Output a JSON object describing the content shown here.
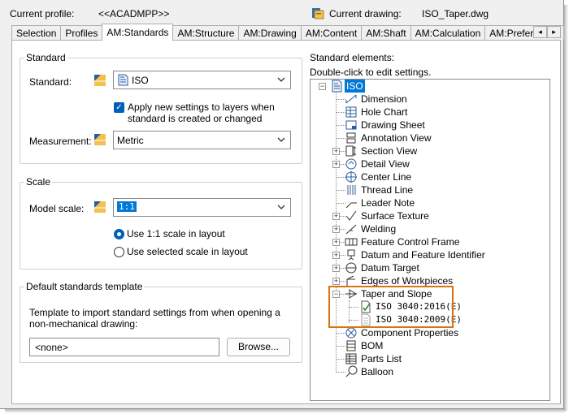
{
  "header": {
    "current_profile_label": "Current profile:",
    "current_profile_value": "<<ACADMPP>>",
    "current_drawing_label": "Current drawing:",
    "current_drawing_value": "ISO_Taper.dwg"
  },
  "tabs": [
    "Selection",
    "Profiles",
    "AM:Standards",
    "AM:Structure",
    "AM:Drawing",
    "AM:Content",
    "AM:Shaft",
    "AM:Calculation",
    "AM:Preferences"
  ],
  "tab_scroll": {
    "left": "◂",
    "right": "▸"
  },
  "standard_group": {
    "title": "Standard",
    "standard_label": "Standard:",
    "standard_value": "ISO",
    "checkbox_label_1": "Apply new settings to layers when",
    "checkbox_label_2": "standard is created or changed",
    "checkbox_checked": true,
    "measurement_label": "Measurement:",
    "measurement_value": "Metric"
  },
  "scale_group": {
    "title": "Scale",
    "model_scale_label": "Model scale:",
    "model_scale_value": "1:1",
    "radio_1_label": "Use 1:1 scale in layout",
    "radio_2_label": "Use selected scale in layout",
    "selected_radio": 1
  },
  "template_group": {
    "title": "Default standards template",
    "description_1": "Template to import standard settings from when opening a",
    "description_2": "non-mechanical drawing:",
    "template_value": "<none>",
    "browse_label": "Browse..."
  },
  "elements": {
    "title": "Standard elements:",
    "hint": "Double-click to edit settings.",
    "root": "ISO",
    "items": [
      {
        "label": "Dimension",
        "icon": "dimension-icon",
        "expandable": false
      },
      {
        "label": "Hole Chart",
        "icon": "hole-chart-icon",
        "expandable": false
      },
      {
        "label": "Drawing Sheet",
        "icon": "drawing-sheet-icon",
        "expandable": false
      },
      {
        "label": "Annotation View",
        "icon": "annotation-view-icon",
        "expandable": false
      },
      {
        "label": "Section View",
        "icon": "section-view-icon",
        "expandable": true
      },
      {
        "label": "Detail View",
        "icon": "detail-view-icon",
        "expandable": true
      },
      {
        "label": "Center Line",
        "icon": "center-line-icon",
        "expandable": false
      },
      {
        "label": "Thread Line",
        "icon": "thread-line-icon",
        "expandable": false
      },
      {
        "label": "Leader Note",
        "icon": "leader-note-icon",
        "expandable": false
      },
      {
        "label": "Surface Texture",
        "icon": "surface-texture-icon",
        "expandable": true
      },
      {
        "label": "Welding",
        "icon": "welding-icon",
        "expandable": true
      },
      {
        "label": "Feature Control Frame",
        "icon": "feature-control-frame-icon",
        "expandable": true
      },
      {
        "label": "Datum and Feature Identifier",
        "icon": "datum-identifier-icon",
        "expandable": true
      },
      {
        "label": "Datum Target",
        "icon": "datum-target-icon",
        "expandable": true
      },
      {
        "label": "Edges of Workpieces",
        "icon": "edges-icon",
        "expandable": true
      },
      {
        "label": "Taper and Slope",
        "icon": "taper-slope-icon",
        "expandable": true,
        "expanded": true
      },
      {
        "label": "ISO 3040:2016(E)",
        "icon": "active-standard-doc-icon",
        "child": true
      },
      {
        "label": "ISO 3040:2009(E)",
        "icon": "standard-doc-icon",
        "child": true
      },
      {
        "label": "Component Properties",
        "icon": "component-properties-icon",
        "expandable": false
      },
      {
        "label": "BOM",
        "icon": "bom-icon",
        "expandable": false
      },
      {
        "label": "Parts List",
        "icon": "parts-list-icon",
        "expandable": false
      },
      {
        "label": "Balloon",
        "icon": "balloon-icon",
        "expandable": false
      }
    ]
  },
  "colors": {
    "accent": "#005fb8",
    "selection": "#0078d7",
    "callout": "#d9730d"
  }
}
